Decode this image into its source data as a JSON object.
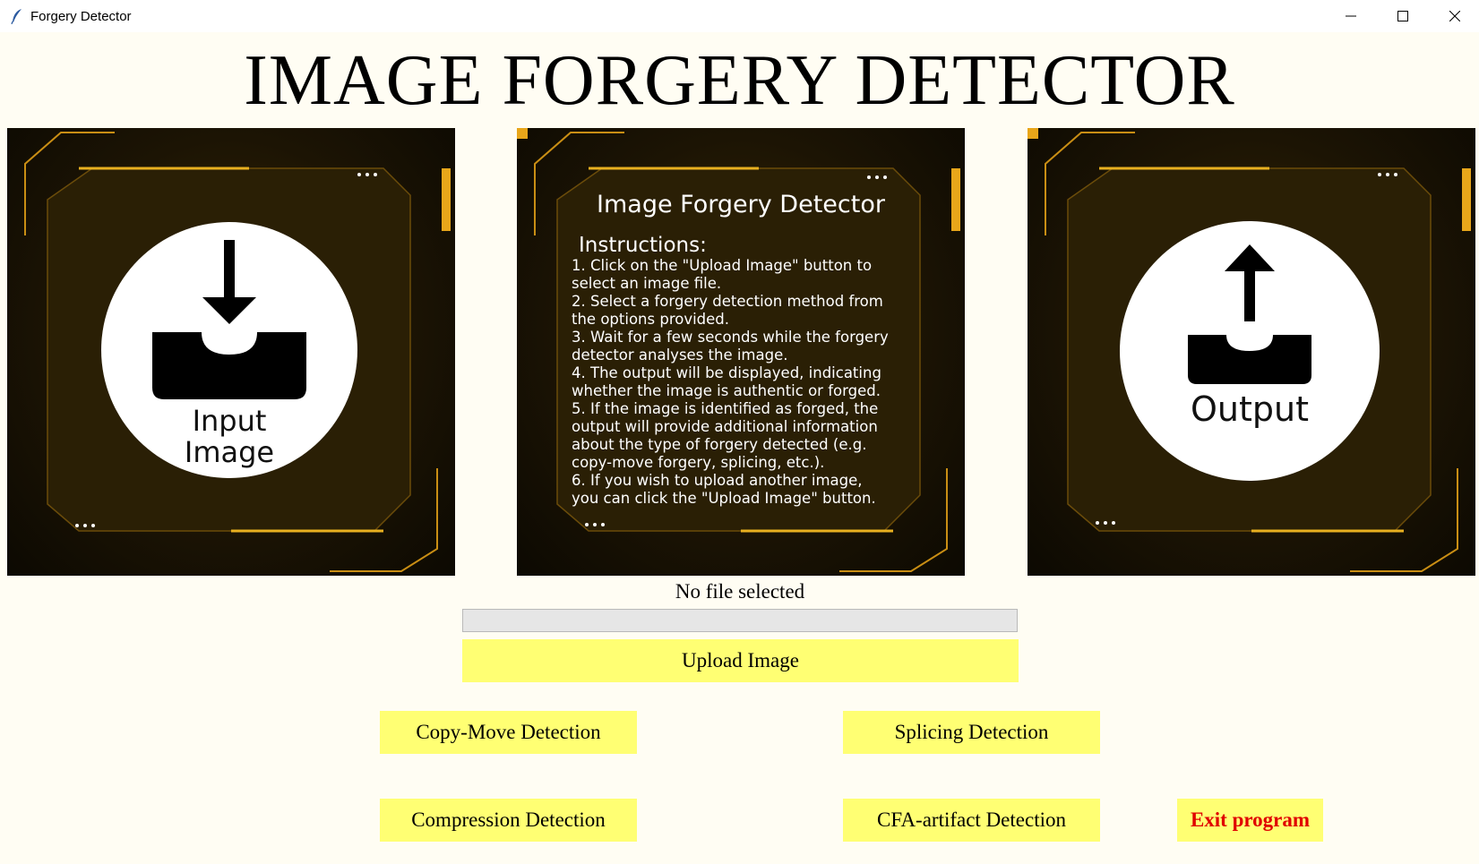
{
  "window": {
    "title": "Forgery Detector",
    "icon": "feather-icon",
    "controls": [
      "minimize-icon",
      "maximize-icon",
      "close-icon"
    ]
  },
  "heading": "IMAGE FORGERY DETECTOR",
  "panels": {
    "input": {
      "line1": "Input",
      "line2": "Image",
      "icon": "download-tray-icon"
    },
    "instructions": {
      "title": "Image Forgery Detector",
      "heading": "Instructions:",
      "text": "1. Click on the \"Upload Image\" button to\nselect an image file.\n2. Select a forgery detection method from\nthe options provided.\n3. Wait for a few seconds while the forgery\ndetector analyses the image.\n4. The output will be displayed, indicating\nwhether the image is authentic or forged.\n5. If the image is identified as forged, the\noutput will provide additional information\nabout the type of forgery detected (e.g.\ncopy-move forgery, splicing, etc.).\n6. If you wish to upload another image,\nyou can click the \"Upload Image\" button."
    },
    "output": {
      "label": "Output",
      "icon": "upload-tray-icon"
    }
  },
  "status": "No file selected",
  "progress": 0,
  "buttons": {
    "upload": "Upload Image",
    "copy_move": "Copy-Move Detection",
    "splicing": "Splicing Detection",
    "compression": "Compression Detection",
    "cfa": "CFA-artifact Detection",
    "exit": "Exit program"
  },
  "colors": {
    "background": "#fffdf3",
    "button": "#ffff73",
    "exit_text": "#e00000",
    "panel_accent": "#e8a61a"
  }
}
